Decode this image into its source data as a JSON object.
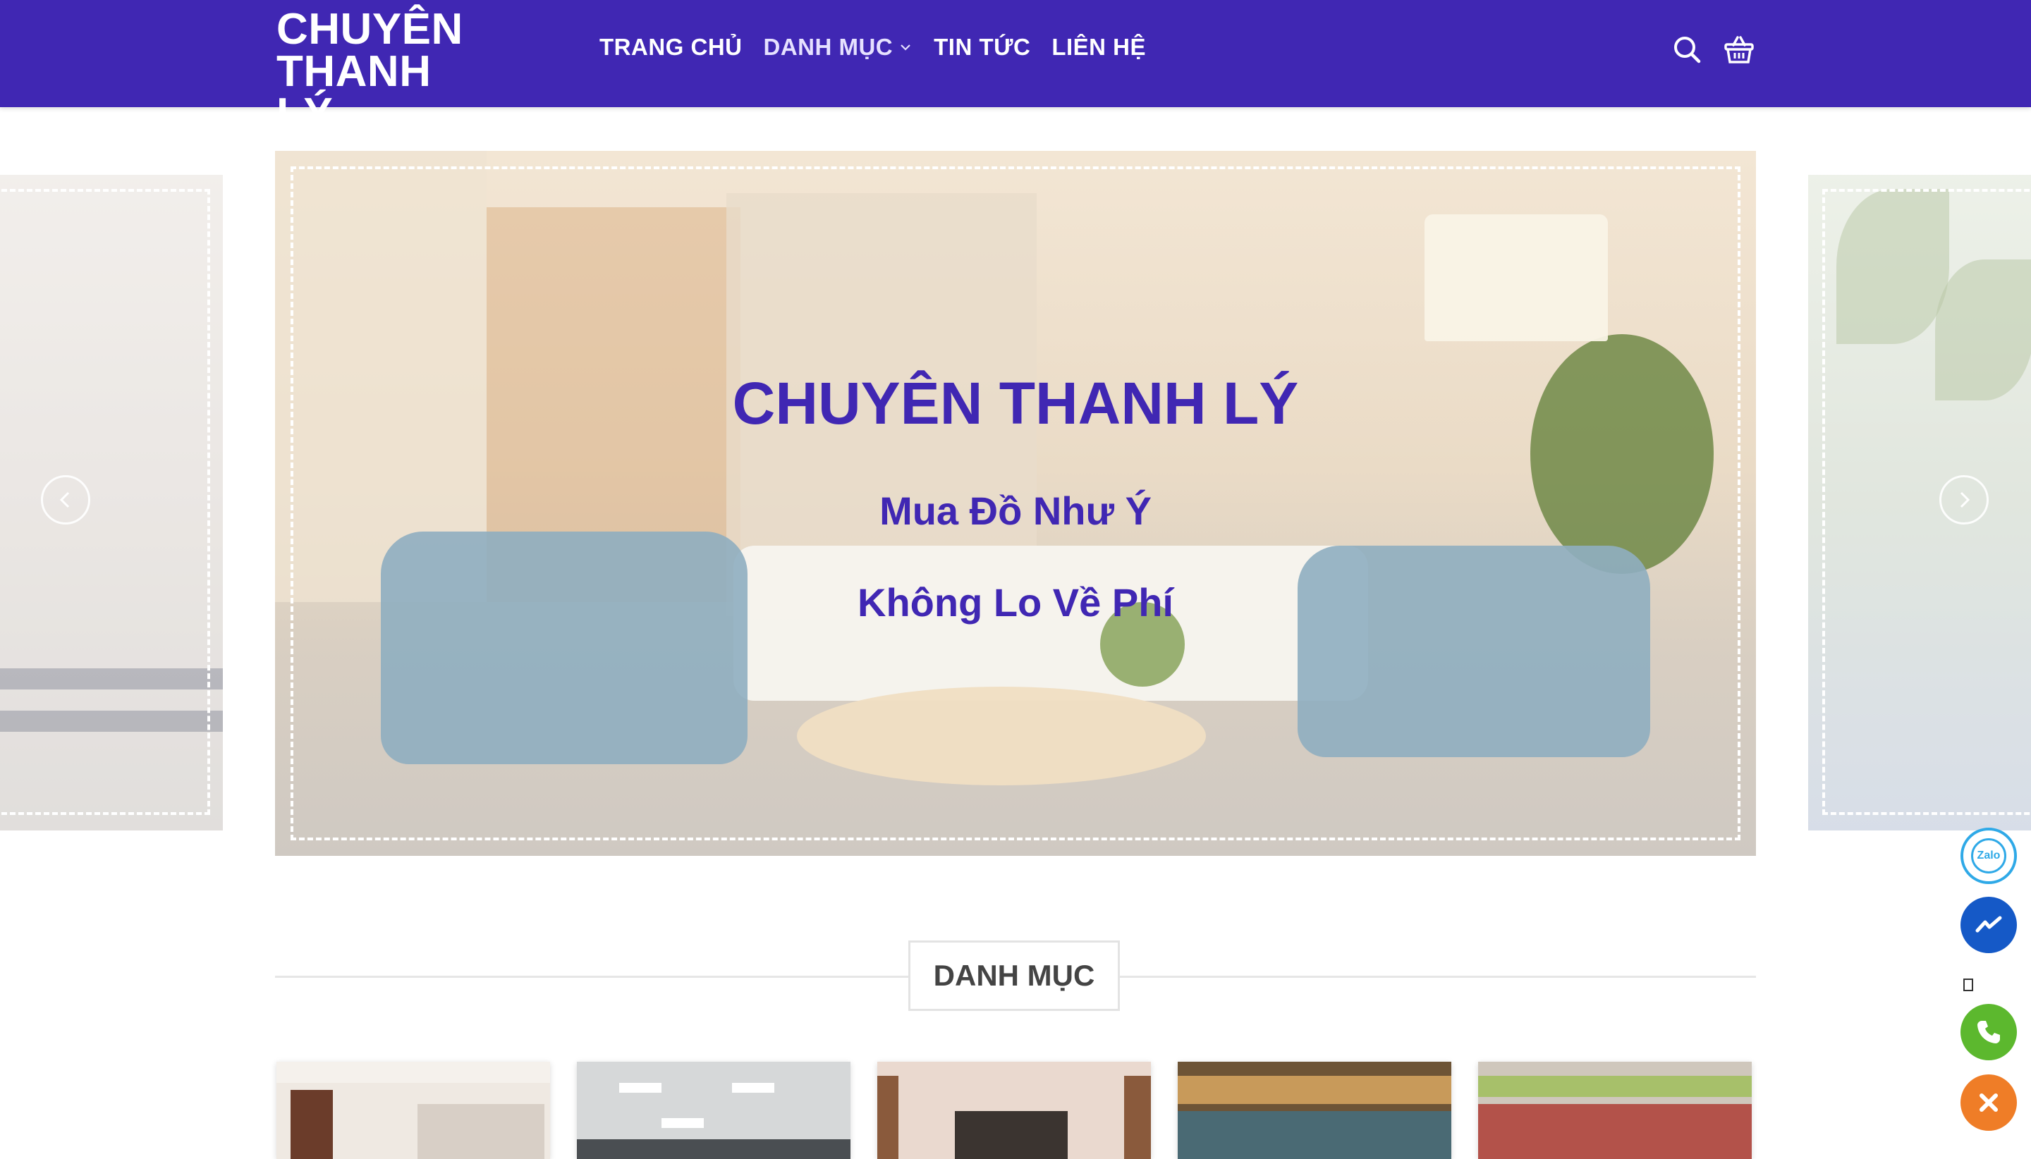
{
  "header": {
    "logo_line1": "CHUYÊN",
    "logo_line2": "THANH LÝ",
    "nav": [
      {
        "label": "TRANG CHỦ"
      },
      {
        "label": "DANH MỤC",
        "has_dropdown": true
      },
      {
        "label": "TIN TỨC"
      },
      {
        "label": "LIÊN HỆ"
      }
    ],
    "icons": [
      "search-icon",
      "basket-icon"
    ]
  },
  "slider": {
    "title": "CHUYÊN THANH LÝ",
    "subtitle1": "Mua Đồ Như Ý",
    "subtitle2": "Không Lo Về Phí",
    "prev_icon": "chevron-left-icon",
    "next_icon": "chevron-right-icon"
  },
  "section": {
    "title": "DANH MỤC"
  },
  "floating_buttons": {
    "zalo_label": "Zalo",
    "icons": [
      "zalo-icon",
      "messenger-icon",
      "phone-icon",
      "close-icon"
    ]
  },
  "colors": {
    "brand": "#4027b3",
    "zalo": "#2fa9e7",
    "messenger": "#1559c7",
    "phone": "#5cb82e",
    "close": "#ef7d27"
  }
}
